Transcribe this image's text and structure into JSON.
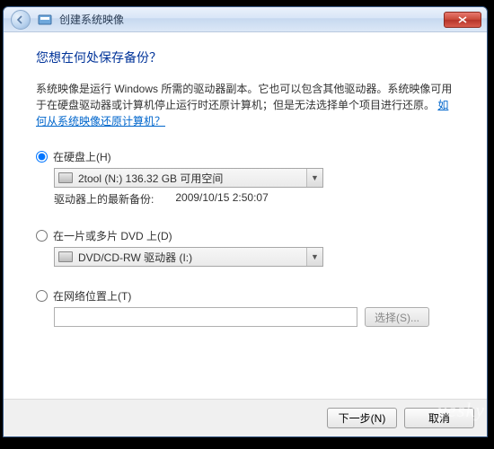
{
  "titlebar": {
    "title": "创建系统映像"
  },
  "heading": "您想在何处保存备份？",
  "description": {
    "text": "系统映像是运行 Windows 所需的驱动器副本。它也可以包含其他驱动器。系统映像可用于在硬盘驱动器或计算机停止运行时还原计算机；但是无法选择单个项目进行还原。",
    "link": "如何从系统映像还原计算机？"
  },
  "options": {
    "hard_disk": {
      "label": "在硬盘上(H)",
      "combo": "2tool (N:)  136.32 GB 可用空间",
      "last_backup_label": "驱动器上的最新备份:",
      "last_backup_value": "2009/10/15 2:50:07"
    },
    "dvd": {
      "label": "在一片或多片 DVD 上(D)",
      "combo": "DVD/CD-RW 驱动器 (I:)"
    },
    "network": {
      "label": "在网络位置上(T)",
      "browse": "选择(S)..."
    }
  },
  "footer": {
    "next": "下一步(N)",
    "cancel": "取消"
  },
  "watermark": "yesky"
}
